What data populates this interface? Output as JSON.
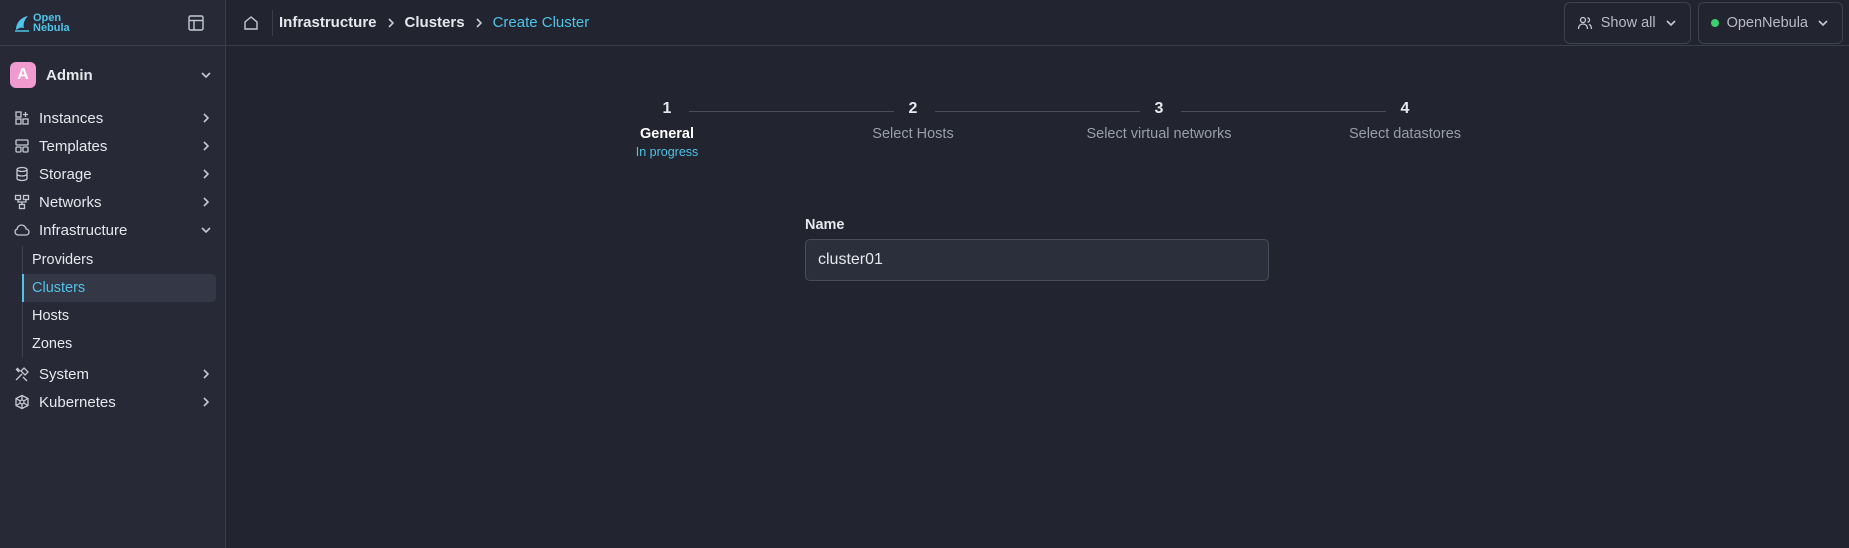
{
  "brand": {
    "name_line1": "Open",
    "name_line2": "Nebula",
    "accent": "#4fc3e8"
  },
  "user": {
    "initial": "A",
    "name": "Admin"
  },
  "sidebar": {
    "items": [
      {
        "label": "Instances",
        "icon": "instances-icon"
      },
      {
        "label": "Templates",
        "icon": "templates-icon"
      },
      {
        "label": "Storage",
        "icon": "storage-icon"
      },
      {
        "label": "Networks",
        "icon": "networks-icon"
      },
      {
        "label": "Infrastructure",
        "icon": "cloud-icon",
        "expanded": true,
        "children": [
          "Providers",
          "Clusters",
          "Hosts",
          "Zones"
        ],
        "active_child": "Clusters"
      },
      {
        "label": "System",
        "icon": "system-icon"
      },
      {
        "label": "Kubernetes",
        "icon": "kubernetes-icon"
      }
    ]
  },
  "breadcrumb": [
    "Infrastructure",
    "Clusters",
    "Create Cluster"
  ],
  "header": {
    "group_filter": "Show all",
    "zone": "OpenNebula",
    "zone_status_color": "#3ccf6e"
  },
  "stepper": {
    "steps": [
      {
        "number": "1",
        "label": "General",
        "status": "In progress"
      },
      {
        "number": "2",
        "label": "Select Hosts"
      },
      {
        "number": "3",
        "label": "Select virtual networks"
      },
      {
        "number": "4",
        "label": "Select datastores"
      }
    ],
    "active_step": 1
  },
  "form": {
    "name_label": "Name",
    "name_value": "cluster01"
  }
}
